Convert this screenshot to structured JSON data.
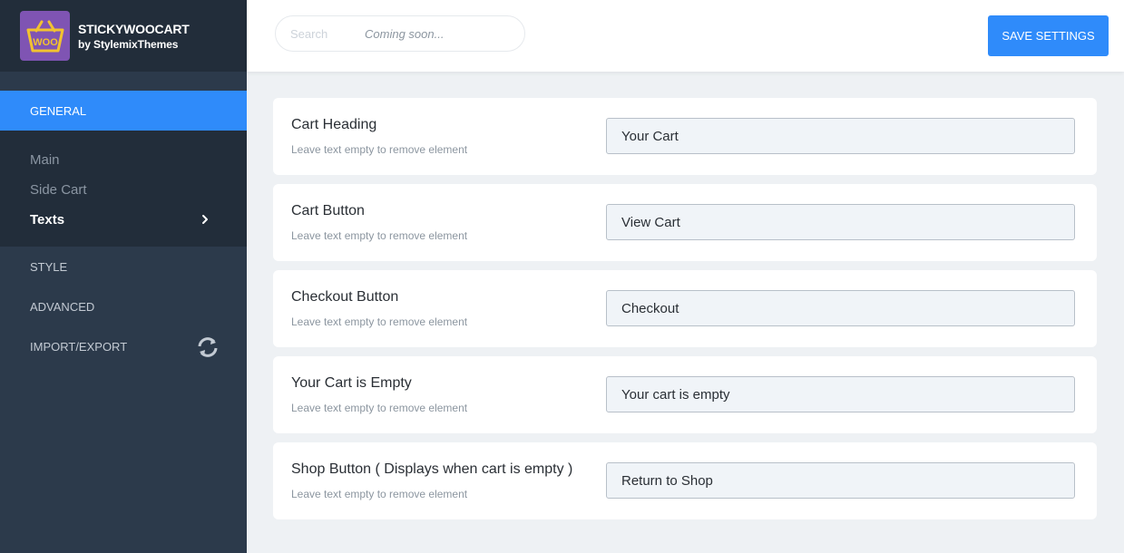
{
  "brand": {
    "logo_text": "WOO",
    "title": "STICKYWOOCART",
    "subtitle": "by StylemixThemes"
  },
  "sidebar": {
    "general_label": "GENERAL",
    "subitems": [
      {
        "label": "Main"
      },
      {
        "label": "Side Cart"
      },
      {
        "label": "Texts"
      }
    ],
    "style_label": "STYLE",
    "advanced_label": "ADVANCED",
    "import_export_label": "IMPORT/EXPORT"
  },
  "topbar": {
    "search_placeholder": "Search",
    "coming_soon": "Coming soon...",
    "save_label": "SAVE SETTINGS"
  },
  "fields": [
    {
      "title": "Cart Heading",
      "description": "Leave text empty to remove element",
      "value": "Your Cart"
    },
    {
      "title": "Cart Button",
      "description": "Leave text empty to remove element",
      "value": "View Cart"
    },
    {
      "title": "Checkout Button",
      "description": "Leave text empty to remove element",
      "value": "Checkout"
    },
    {
      "title": "Your Cart is Empty",
      "description": "Leave text empty to remove element",
      "value": "Your cart is empty"
    },
    {
      "title": "Shop Button ( Displays when cart is empty )",
      "description": "Leave text empty to remove element",
      "value": "Return to Shop"
    }
  ],
  "icons": {
    "logo": "basket-icon",
    "chevron": "chevron-right-icon",
    "sync": "sync-icon"
  },
  "colors": {
    "accent": "#2f8bfa",
    "sidebar": "#2c3a4b",
    "sidebar_dark": "#222d3a",
    "logo_bg": "#7f54b3",
    "logo_basket": "#f2c230"
  }
}
